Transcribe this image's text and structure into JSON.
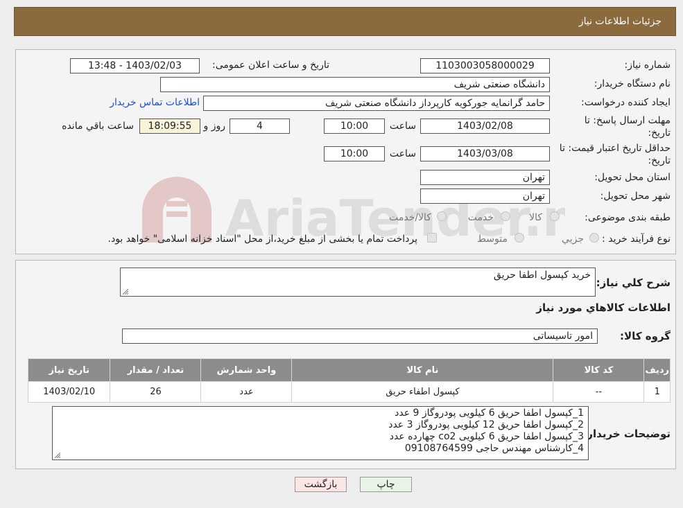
{
  "header": {
    "title": "جزئیات اطلاعات نیاز"
  },
  "watermark": {
    "text": "AriaTender.neT"
  },
  "form": {
    "need_number_label": "شماره نیاز:",
    "need_number": "1103003058000029",
    "announce_label": "تاریخ و ساعت اعلان عمومی:",
    "announce_value": "1403/02/03 - 13:48",
    "buyer_org_label": "نام دستگاه خریدار:",
    "buyer_org": "دانشگاه صنعتی شریف",
    "creator_label": "ایجاد کننده درخواست:",
    "creator": "حامد گرانمایه جورکویه کارپرداز دانشگاه صنعتی شریف",
    "contact_link": "اطلاعات تماس خریدار",
    "deadline_label_1": "مهلت ارسال پاسخ: تا",
    "deadline_label_2": "تاریخ:",
    "deadline_date": "1403/02/08",
    "time_label": "ساعت",
    "deadline_time": "10:00",
    "days_value": "4",
    "days_label": "روز و",
    "remaining_time": "18:09:55",
    "remaining_label": "ساعت باقي مانده",
    "validity_label_1": "حداقل تاریخ اعتبار قیمت: تا",
    "validity_label_2": "تاریخ:",
    "validity_date": "1403/03/08",
    "validity_time": "10:00",
    "province_label": "استان محل تحویل:",
    "province": "تهران",
    "city_label": "شهر محل تحویل:",
    "city": "تهران",
    "category_label": "طبقه بندی موضوعی:",
    "category_options": [
      "کالا",
      "خدمت",
      "کالا/خدمت"
    ],
    "process_label": "نوع فرآیند خرید :",
    "process_options": [
      "جزيي",
      "متوسط"
    ],
    "process_note": "پرداخت تمام یا بخشی از مبلغ خرید،از محل \"اسناد خزانه اسلامی\" خواهد بود."
  },
  "details": {
    "summary_label": "شرح کلي نياز:",
    "summary": "خرید کپسول اطفا حریق",
    "goods_info_title": "اطلاعات کالاهاي مورد نياز",
    "group_label": "گروه کالا:",
    "group": "امور تاسیساتی",
    "table": {
      "headers": [
        "رديف",
        "کد کالا",
        "نام کالا",
        "واحد شمارش",
        "تعداد / مقدار",
        "تاریخ نیاز"
      ],
      "rows": [
        [
          "1",
          "--",
          "کپسول اطفاء حریق",
          "عدد",
          "26",
          "1403/02/10"
        ]
      ]
    },
    "buyer_notes_label": "توضیحات خریدار:",
    "buyer_notes": [
      "1_کپسول اطفا حریق 6 کیلویی پودروگاز 9 عدد",
      "2_کپسول اطفا حریق 12 کیلویی پودروگاز 3 عدد",
      "3_کپسول اطفا حریق 6 کیلویی co2 چهارده عدد",
      "4_کارشناس مهندس حاجی 09108764599"
    ]
  },
  "buttons": {
    "print": "چاپ",
    "back": "بازگشت"
  }
}
